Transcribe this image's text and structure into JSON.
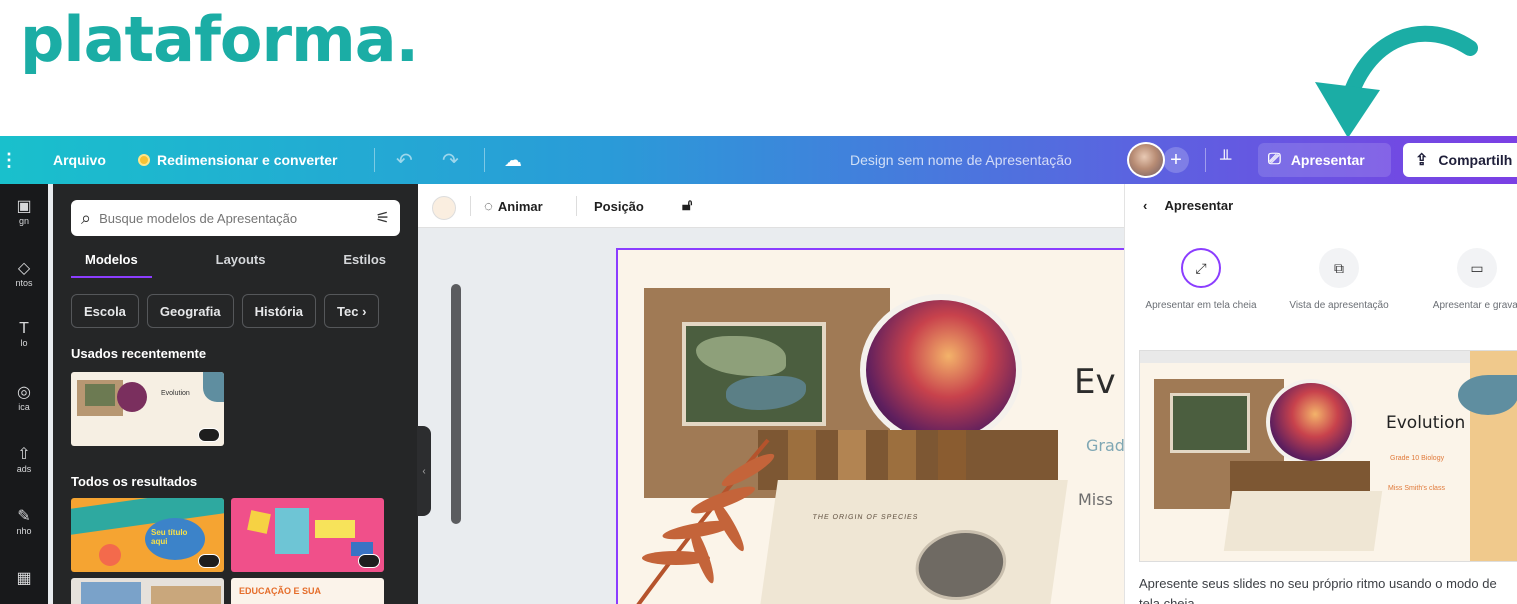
{
  "caption": "plataforma.",
  "topbar": {
    "menu_label": "Arquivo",
    "resize_label": "Redimensionar e converter",
    "doc_title": "Design sem nome de Apresentação",
    "present_label": "Apresentar",
    "share_label": "Compartilh"
  },
  "rail": {
    "items": [
      "gn",
      "ntos",
      "lo",
      "ica",
      "ads",
      "nho",
      ""
    ]
  },
  "panel": {
    "search_placeholder": "Busque modelos de Apresentação",
    "tabs": [
      "Modelos",
      "Layouts",
      "Estilos"
    ],
    "chips": [
      "Escola",
      "Geografia",
      "História",
      "Tec"
    ],
    "recent_title": "Usados recentemente",
    "all_results_title": "Todos os resultados",
    "recent_thumb_title": "Evolution",
    "result1_text": "Seu título aqui",
    "result4_text": "EDUCAÇÃO E SUA"
  },
  "canvas_toolbar": {
    "animate_label": "Animar",
    "position_label": "Posição"
  },
  "slide": {
    "title_partial": "Ev",
    "subtitle_partial": "Grad",
    "author_partial": "Miss",
    "book_text": "THE ORIGIN OF SPECIES"
  },
  "present_panel": {
    "header": "Apresentar",
    "options": [
      {
        "label": "Apresentar em tela cheia",
        "icon": "fullscreen-icon"
      },
      {
        "label": "Vista de apresentação",
        "icon": "presenter-view-icon"
      },
      {
        "label": "Apresentar e gravar",
        "icon": "record-icon"
      }
    ],
    "preview_title": "Evolution",
    "preview_subtitle": "Grade 10 Biology",
    "preview_author": "Miss Smith's class",
    "description": "Apresente seus slides no seu próprio ritmo usando o modo de tela cheia."
  },
  "colors": {
    "caption": "#1bada5",
    "accent": "#8b3dff",
    "arrow": "#1bada5"
  }
}
